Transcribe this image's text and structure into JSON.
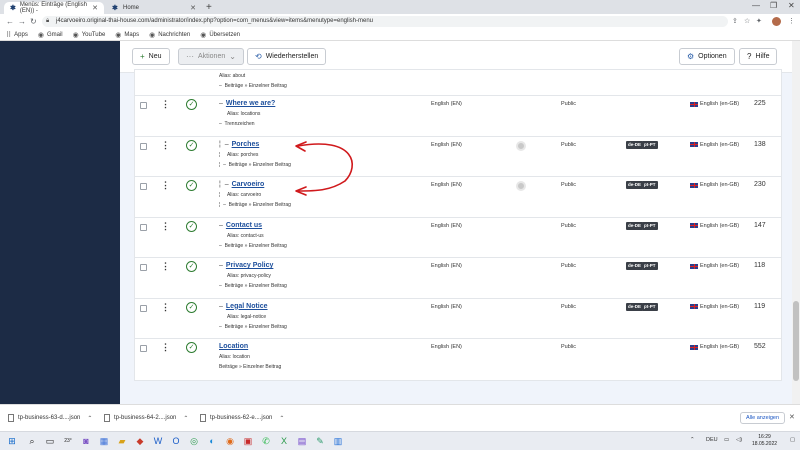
{
  "browser": {
    "tabs": [
      {
        "title": "Menüs: Einträge (English (EN)) -",
        "active": true
      },
      {
        "title": "Home",
        "active": false
      }
    ],
    "url": "j4carvoeiro.original-thai-house.com/administrator/index.php?option=com_menus&view=items&menutype=english-menu",
    "bookmarks": [
      "Apps",
      "Gmail",
      "YouTube",
      "Maps",
      "Nachrichten",
      "Übersetzen"
    ]
  },
  "toolbar": {
    "new_label": "Neu",
    "actions_label": "Aktionen",
    "restore_label": "Wiederherstellen",
    "options_label": "Optionen",
    "help_label": "Hilfe"
  },
  "items": [
    {
      "partial": true,
      "alias": "Alias: about",
      "type": "Beiträge » Einzelner Beitrag"
    },
    {
      "title": "Where we are?",
      "alias": "Alias: locations",
      "type": "Trennzeichen",
      "language": "English (EN)",
      "access": "Public",
      "associations": [],
      "lang_flag": "English (en-GB)",
      "id": "225"
    },
    {
      "title": "Porches",
      "alias": "Alias: porches",
      "type": "Beiträge » Einzelner Beitrag",
      "language": "English (EN)",
      "access": "Public",
      "associations": [
        "de-DE",
        "pt-PT"
      ],
      "lang_flag": "English (en-GB)",
      "id": "138"
    },
    {
      "title": "Carvoeiro",
      "alias": "Alias: carvoeiro",
      "type": "Beiträge » Einzelner Beitrag",
      "language": "English (EN)",
      "access": "Public",
      "associations": [
        "de-DE",
        "pt-PT"
      ],
      "lang_flag": "English (en-GB)",
      "id": "230"
    },
    {
      "title": "Contact us",
      "alias": "Alias: contact-us",
      "type": "Beiträge » Einzelner Beitrag",
      "language": "English (EN)",
      "access": "Public",
      "associations": [
        "de-DE",
        "pt-PT"
      ],
      "lang_flag": "English (en-GB)",
      "id": "147"
    },
    {
      "title": "Privacy Policy",
      "alias": "Alias: privacy-policy",
      "type": "Beiträge » Einzelner Beitrag",
      "language": "English (EN)",
      "access": "Public",
      "associations": [
        "de-DE",
        "pt-PT"
      ],
      "lang_flag": "English (en-GB)",
      "id": "118"
    },
    {
      "title": "Legal Notice",
      "alias": "Alias: legal-notice",
      "type": "Beiträge » Einzelner Beitrag",
      "language": "English (EN)",
      "access": "Public",
      "associations": [
        "de-DE",
        "pt-PT"
      ],
      "lang_flag": "English (en-GB)",
      "id": "119"
    },
    {
      "title": "Location",
      "alias": "Alias: location",
      "type": "Beiträge » Einzelner Beitrag",
      "language": "English (EN)",
      "access": "Public",
      "associations": [],
      "lang_flag": "English (en-GB)",
      "id": "552"
    }
  ],
  "downloads": [
    {
      "name": "tp-business-63-d....json"
    },
    {
      "name": "tp-business-64-2....json"
    },
    {
      "name": "tp-business-62-e....json"
    }
  ],
  "downloads_show_all": "Alle anzeigen",
  "taskbar": {
    "weather": "23°",
    "language": "DEU",
    "time": "16:29",
    "date": "18.05.2022"
  },
  "colors": {
    "sidebar": "#1c2b45",
    "link": "#1d4f9c",
    "published": "#2f7d32",
    "annotation_arrow": "#d0191c"
  }
}
